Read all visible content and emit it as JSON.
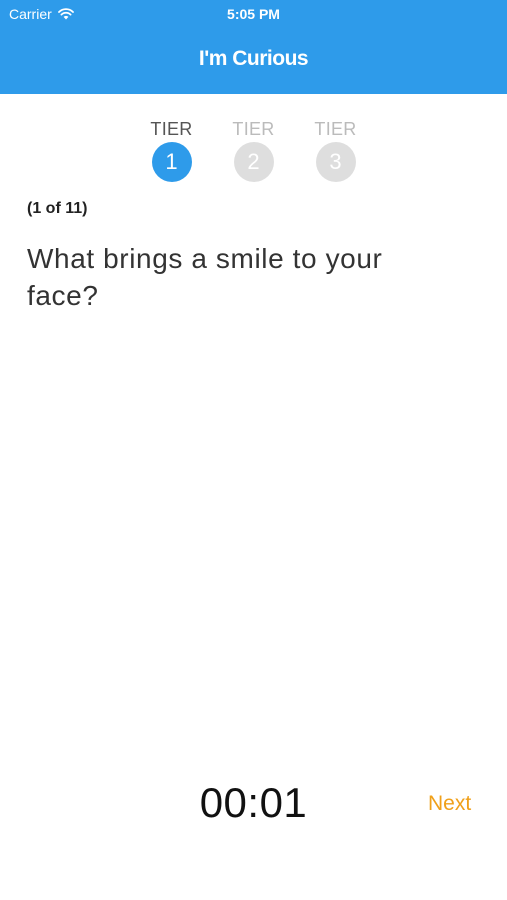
{
  "status_bar": {
    "carrier": "Carrier",
    "time": "5:05 PM",
    "wifi_icon": "wifi-icon"
  },
  "nav": {
    "title": "I'm Curious",
    "background_color": "#2E9BEA"
  },
  "tiers": [
    {
      "label": "TIER",
      "number": "1",
      "active": true
    },
    {
      "label": "TIER",
      "number": "2",
      "active": false
    },
    {
      "label": "TIER",
      "number": "3",
      "active": false
    }
  ],
  "question": {
    "progress": "(1 of 11)",
    "text": "What brings a smile to your face?"
  },
  "footer": {
    "timer": "00:01",
    "next_label": "Next",
    "next_color": "#F0A01A"
  }
}
